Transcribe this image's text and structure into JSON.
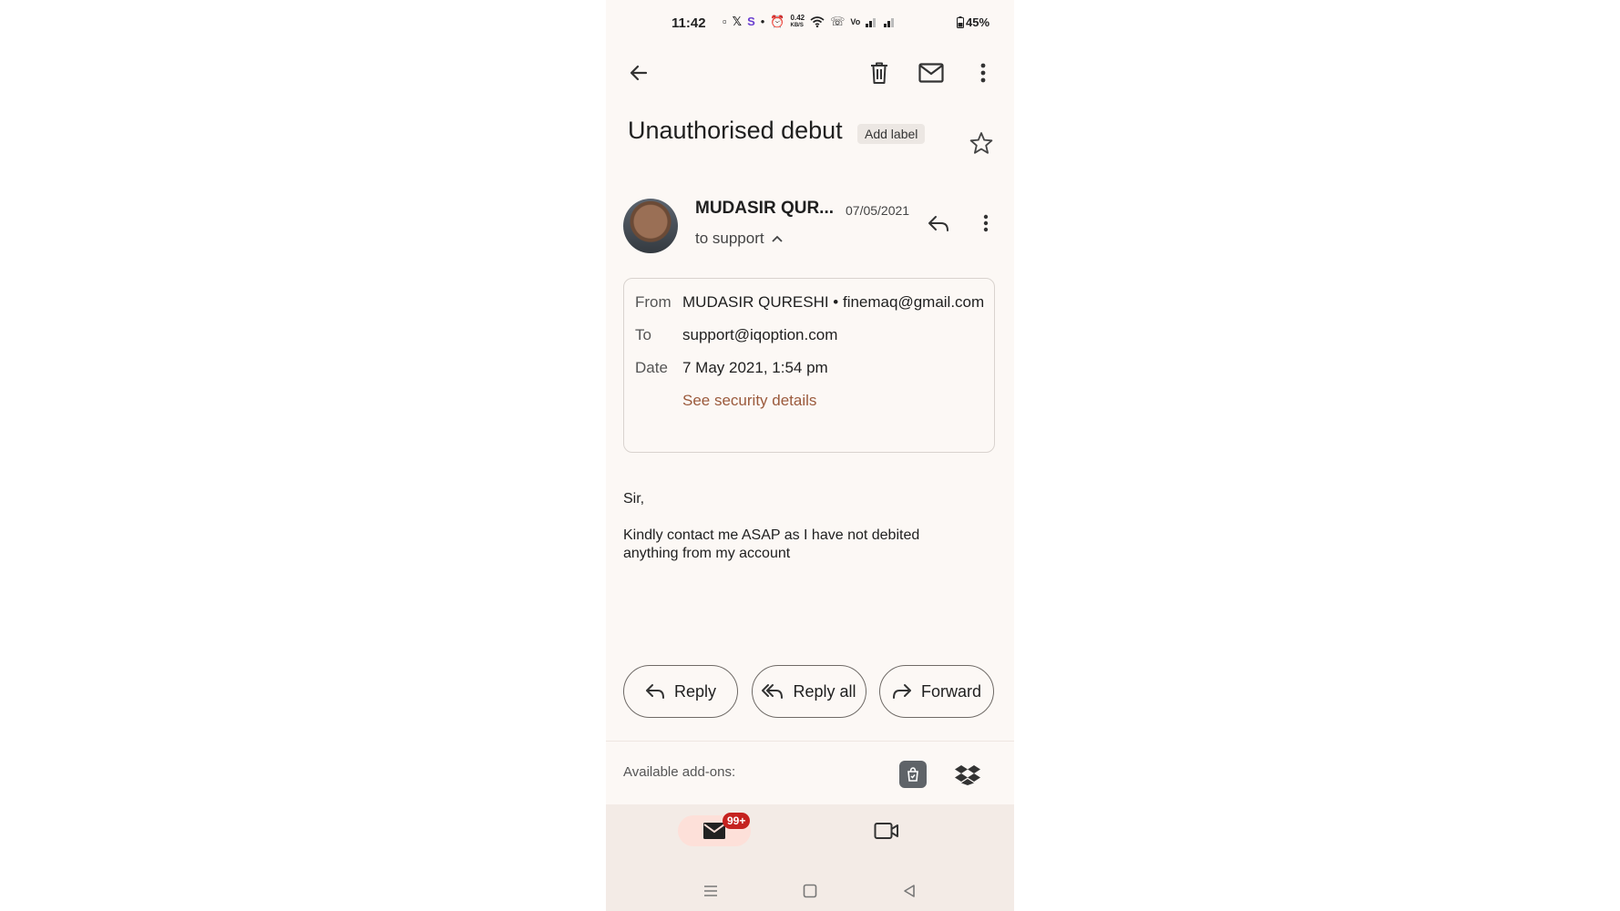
{
  "status_bar": {
    "time": "11:42",
    "speed": "0.42",
    "speed_unit": "KB/S",
    "battery": "45%"
  },
  "toolbar": {
    "back_icon": "arrow-left-icon",
    "delete_icon": "trash-icon",
    "mark_unread_icon": "mail-icon",
    "more_icon": "more-vert-icon"
  },
  "email": {
    "subject": "Unauthorised debut",
    "add_label": "Add label",
    "sender_short": "MUDASIR QUR...",
    "date_short": "07/05/2021",
    "to_line": "to support",
    "details": {
      "from_label": "From",
      "from_value": "MUDASIR QURESHI • finemaq@gmail.com",
      "to_label": "To",
      "to_value": "support@iqoption.com",
      "date_label": "Date",
      "date_value": "7 May 2021, 1:54 pm",
      "security_link": "See security details"
    },
    "body": {
      "greeting": "Sir,",
      "message": "Kindly contact me ASAP as I have not debited anything from my account"
    }
  },
  "actions": {
    "reply": "Reply",
    "reply_all": "Reply all",
    "forward": "Forward"
  },
  "addons": {
    "label": "Available add-ons:"
  },
  "bottom_nav": {
    "mail_badge": "99+"
  },
  "colors": {
    "background": "#fcf8f5",
    "link": "#9b5a3c",
    "badge": "#c5221f",
    "nav_pill": "#fde0d9"
  }
}
